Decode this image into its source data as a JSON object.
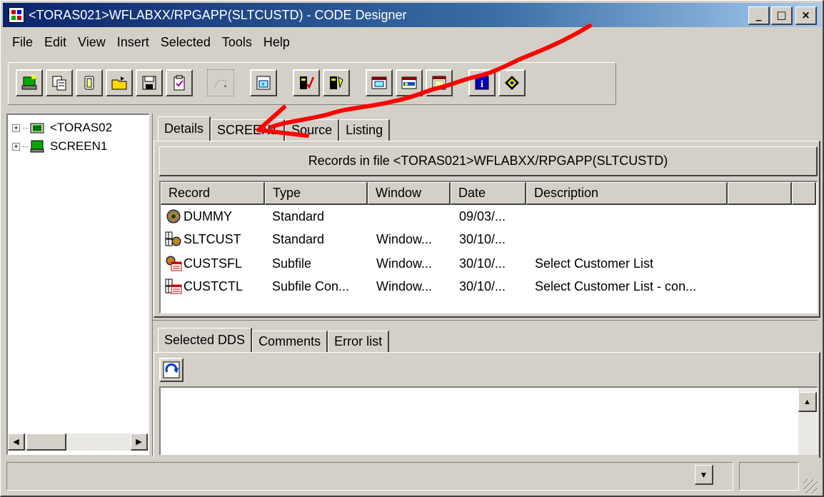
{
  "window": {
    "title": "<TORAS021>WFLABXX/RPGAPP(SLTCUSTD) - CODE Designer",
    "minimize": "_",
    "maximize": "□",
    "close": "×"
  },
  "menu": [
    "File",
    "Edit",
    "View",
    "Insert",
    "Selected",
    "Tools",
    "Help"
  ],
  "toolbar": {
    "buttons": [
      "new-icon",
      "copy-records-icon",
      "new-file-icon",
      "open-icon",
      "save-icon",
      "properties-icon",
      "arrange-icon",
      "screen-layout-icon",
      "check-dds-icon",
      "edit-dds-icon",
      "record-window-icon",
      "field-icon",
      "subfile-icon",
      "info-icon",
      "help-icon"
    ]
  },
  "tree": {
    "items": [
      {
        "label": "<TORAS02",
        "icon": "library-icon"
      },
      {
        "label": "SCREEN1",
        "icon": "screen-icon"
      }
    ]
  },
  "tabs_top": [
    "Details",
    "SCREEN1",
    "Source",
    "Listing"
  ],
  "records_header": "Records in file <TORAS021>WFLABXX/RPGAPP(SLTCUSTD)",
  "list": {
    "columns": [
      "Record",
      "Type",
      "Window",
      "Date",
      "Description"
    ],
    "rows": [
      {
        "record": "DUMMY",
        "type": "Standard",
        "window": "",
        "date": "09/03/...",
        "description": "",
        "icon": "dummy-record-icon"
      },
      {
        "record": "SLTCUST",
        "type": "Standard",
        "window": "Window...",
        "date": "30/10/...",
        "description": "",
        "icon": "standard-record-icon"
      },
      {
        "record": "CUSTSFL",
        "type": "Subfile",
        "window": "Window...",
        "date": "30/10/...",
        "description": "Select Customer List",
        "icon": "subfile-record-icon"
      },
      {
        "record": "CUSTCTL",
        "type": "Subfile Con...",
        "window": "Window...",
        "date": "30/10/...",
        "description": "Select Customer List - con...",
        "icon": "subfile-control-icon"
      }
    ]
  },
  "tabs_bottom": [
    "Selected DDS",
    "Comments",
    "Error list"
  ],
  "colors": {
    "title_start": "#0a246a",
    "title_end": "#a6caf0",
    "face": "#d4d0c8",
    "annotation": "#ff0000"
  }
}
